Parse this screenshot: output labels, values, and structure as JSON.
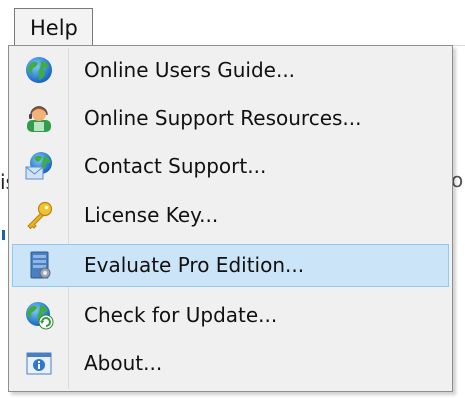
{
  "menubar": {
    "help_label": "Help"
  },
  "background": {
    "left_fragment": "is",
    "right_fragment": "o"
  },
  "help_menu": {
    "items": [
      {
        "label": "Online Users Guide...",
        "icon": "globe-icon"
      },
      {
        "label": "Online Support Resources...",
        "icon": "support-person-icon"
      },
      {
        "label": "Contact Support...",
        "icon": "globe-mail-icon"
      },
      {
        "label": "License Key...",
        "icon": "key-icon"
      },
      {
        "label": "Evaluate Pro Edition...",
        "icon": "server-icon",
        "highlighted": true
      },
      {
        "label": "Check for Update...",
        "icon": "globe-refresh-icon"
      },
      {
        "label": "About...",
        "icon": "info-window-icon"
      }
    ]
  },
  "colors": {
    "highlight_bg": "#cce4f7",
    "highlight_border": "#90c8f6",
    "menu_bg": "#f0f0f0"
  }
}
